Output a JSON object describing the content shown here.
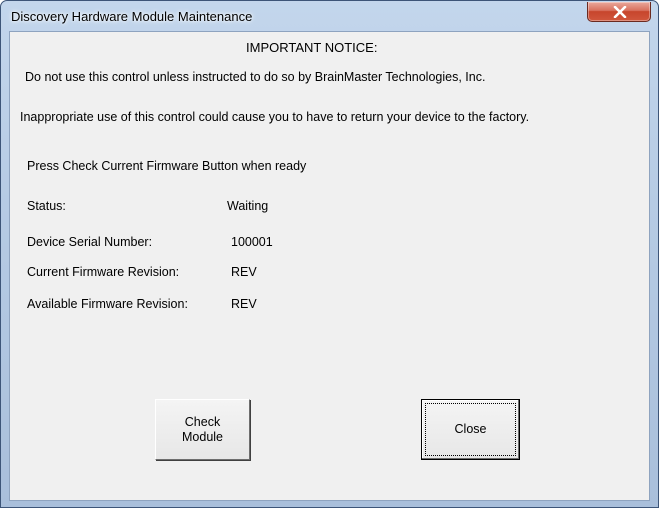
{
  "window": {
    "title": "Discovery Hardware Module Maintenance"
  },
  "notice": {
    "heading": "IMPORTANT NOTICE:",
    "line1": "Do not use this control unless instructed to do so by BrainMaster Technologies, Inc.",
    "line2": "Inappropriate use of this control could cause you to have to return your device to the factory."
  },
  "instruction": "Press Check Current Firmware Button when ready",
  "fields": {
    "status_label": "Status:",
    "status_value": "Waiting",
    "serial_label": "Device Serial Number:",
    "serial_value": "100001",
    "current_label": "Current Firmware Revision:",
    "current_value": "REV",
    "available_label": "Available Firmware Revision:",
    "available_value": "REV"
  },
  "buttons": {
    "check_label": "Check\nModule",
    "close_label": "Close"
  },
  "icons": {
    "window_close": "close-icon"
  }
}
